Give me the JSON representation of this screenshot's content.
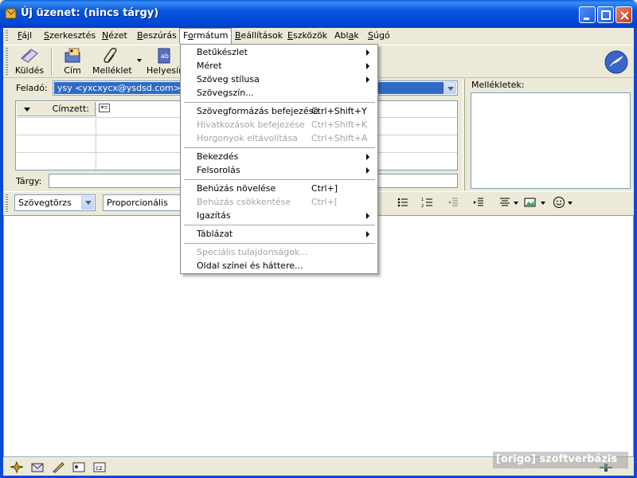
{
  "window": {
    "title": "Új üzenet: (nincs tárgy)"
  },
  "menubar": {
    "items": [
      {
        "pre": "",
        "acc": "F",
        "post": "ájl"
      },
      {
        "pre": "",
        "acc": "S",
        "post": "zerkesztés"
      },
      {
        "pre": "",
        "acc": "N",
        "post": "ézet"
      },
      {
        "pre": "",
        "acc": "B",
        "post": "eszúrás"
      },
      {
        "pre": "F",
        "acc": "o",
        "post": "rmátum"
      },
      {
        "pre": "",
        "acc": "B",
        "post": "eállítások"
      },
      {
        "pre": "",
        "acc": "E",
        "post": "szközök"
      },
      {
        "pre": "Abl",
        "acc": "a",
        "post": "k"
      },
      {
        "pre": "",
        "acc": "S",
        "post": "úgó"
      }
    ]
  },
  "toolbar": {
    "send_label": "Küldés",
    "address_label": "Cím",
    "attach_label": "Melléklet",
    "spell_label": "Helyesír"
  },
  "header": {
    "from_label": "Feladó:",
    "from_value": "ysy <yxcxycx@ysdsd.com>",
    "recipient_type": "Címzett:",
    "subject_label": "Tárgy:",
    "attachments_label": "Mellékletek:"
  },
  "format_bar": {
    "style_value": "Szövegtörzs",
    "font_value": "Proporcionális"
  },
  "format_menu": {
    "items": [
      {
        "text": "Betűkészlet",
        "shortcut": "",
        "submenu": true,
        "disabled": false
      },
      {
        "text": "Méret",
        "shortcut": "",
        "submenu": true,
        "disabled": false
      },
      {
        "text": "Szöveg stílusa",
        "shortcut": "",
        "submenu": true,
        "disabled": false
      },
      {
        "text": "Szövegszín...",
        "shortcut": "",
        "submenu": false,
        "disabled": false
      },
      {
        "text": "Szövegformázás befejezése",
        "shortcut": "Ctrl+Shift+Y",
        "submenu": false,
        "disabled": false
      },
      {
        "text": "Hivatkozások befejezése",
        "shortcut": "Ctrl+Shift+K",
        "submenu": false,
        "disabled": true
      },
      {
        "text": "Horgonyok eltávolítása",
        "shortcut": "Ctrl+Shift+A",
        "submenu": false,
        "disabled": true
      },
      {
        "text": "Bekezdés",
        "shortcut": "",
        "submenu": true,
        "disabled": false
      },
      {
        "text": "Felsorolás",
        "shortcut": "",
        "submenu": true,
        "disabled": false
      },
      {
        "text": "Behúzás növelése",
        "shortcut": "Ctrl+]",
        "submenu": false,
        "disabled": false
      },
      {
        "text": "Behúzás csökkentése",
        "shortcut": "Ctrl+[",
        "submenu": false,
        "disabled": true
      },
      {
        "text": "Igazítás",
        "shortcut": "",
        "submenu": true,
        "disabled": false
      },
      {
        "text": "Táblázat",
        "shortcut": "",
        "submenu": true,
        "disabled": false
      },
      {
        "text": "Speciális tulajdonságok...",
        "shortcut": "",
        "submenu": false,
        "disabled": true
      },
      {
        "text": "Oldal színei és háttere...",
        "shortcut": "",
        "submenu": false,
        "disabled": false
      }
    ]
  },
  "watermark": "[origo] szoftverbázis",
  "colors": {
    "titlebar": "#0a5fd8",
    "selection": "#316ac5",
    "chrome": "#ece9d8"
  }
}
